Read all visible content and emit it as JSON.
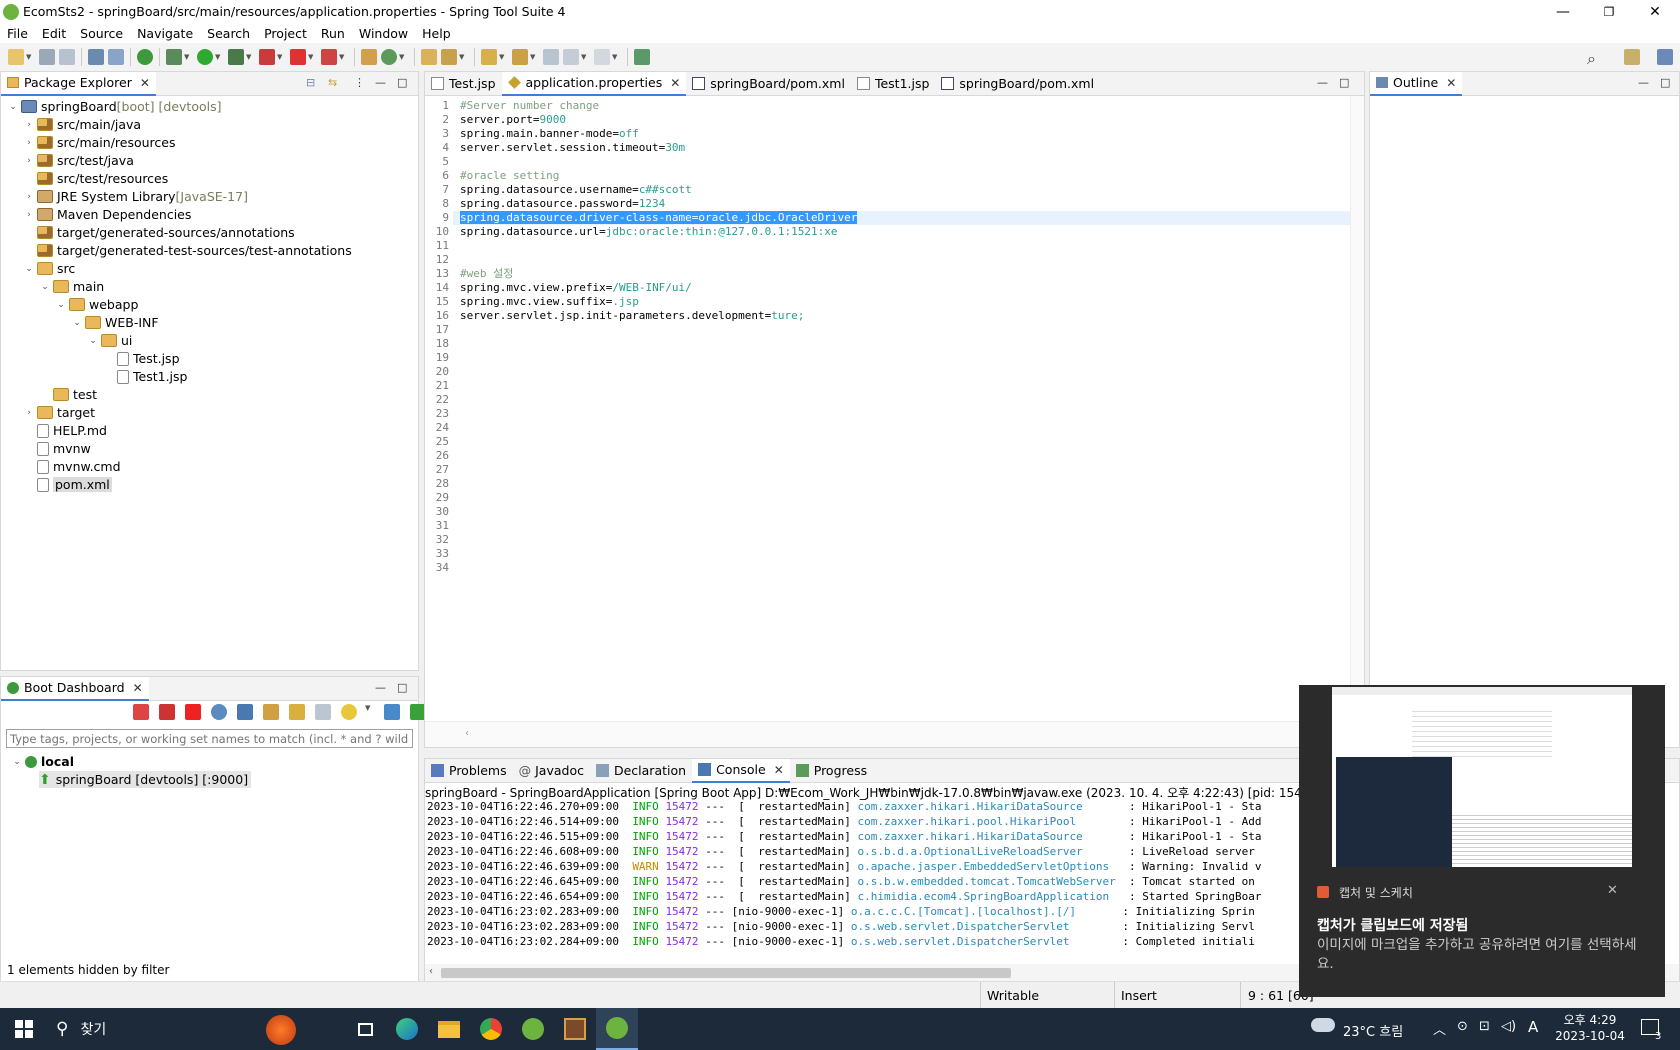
{
  "window": {
    "title": "EcomSts2 - springBoard/src/main/resources/application.properties - Spring Tool Suite 4",
    "minimize": "—",
    "maximize": "❐",
    "close": "✕"
  },
  "menu": [
    "File",
    "Edit",
    "Source",
    "Navigate",
    "Search",
    "Project",
    "Run",
    "Window",
    "Help"
  ],
  "package_explorer": {
    "tab": "Package Explorer",
    "tree": [
      {
        "label": "springBoard",
        "deco": " [boot] [devtools]",
        "indent": 0,
        "twisty": "⌄",
        "icon": "project"
      },
      {
        "label": "src/main/java",
        "indent": 1,
        "twisty": "›",
        "icon": "pkgf"
      },
      {
        "label": "src/main/resources",
        "indent": 1,
        "twisty": "›",
        "icon": "pkgf"
      },
      {
        "label": "src/test/java",
        "indent": 1,
        "twisty": "›",
        "icon": "pkgf"
      },
      {
        "label": "src/test/resources",
        "indent": 1,
        "twisty": "",
        "icon": "pkgf"
      },
      {
        "label": "JRE System Library",
        "deco": " [JavaSE-17]",
        "indent": 1,
        "twisty": "›",
        "icon": "lib"
      },
      {
        "label": "Maven Dependencies",
        "indent": 1,
        "twisty": "›",
        "icon": "lib"
      },
      {
        "label": "target/generated-sources/annotations",
        "indent": 1,
        "twisty": "",
        "icon": "pkgf"
      },
      {
        "label": "target/generated-test-sources/test-annotations",
        "indent": 1,
        "twisty": "",
        "icon": "pkgf"
      },
      {
        "label": "src",
        "indent": 1,
        "twisty": "⌄",
        "icon": "folder"
      },
      {
        "label": "main",
        "indent": 2,
        "twisty": "⌄",
        "icon": "folder"
      },
      {
        "label": "webapp",
        "indent": 3,
        "twisty": "⌄",
        "icon": "folder"
      },
      {
        "label": "WEB-INF",
        "indent": 4,
        "twisty": "⌄",
        "icon": "folder"
      },
      {
        "label": "ui",
        "indent": 5,
        "twisty": "⌄",
        "icon": "folder"
      },
      {
        "label": "Test.jsp",
        "indent": 6,
        "twisty": "",
        "icon": "file"
      },
      {
        "label": "Test1.jsp",
        "indent": 6,
        "twisty": "",
        "icon": "file"
      },
      {
        "label": "test",
        "indent": 2,
        "twisty": "",
        "icon": "folder"
      },
      {
        "label": "target",
        "indent": 1,
        "twisty": "›",
        "icon": "folder"
      },
      {
        "label": "HELP.md",
        "indent": 1,
        "twisty": "",
        "icon": "file"
      },
      {
        "label": "mvnw",
        "indent": 1,
        "twisty": "",
        "icon": "file"
      },
      {
        "label": "mvnw.cmd",
        "indent": 1,
        "twisty": "",
        "icon": "file"
      },
      {
        "label": "pom.xml",
        "indent": 1,
        "twisty": "",
        "icon": "file",
        "selected": true
      }
    ]
  },
  "boot_dashboard": {
    "tab": "Boot Dashboard",
    "filter_placeholder": "Type tags, projects, or working set names to match (incl. * and ? wildcards)",
    "local": "local",
    "app": "springBoard [devtools] [:9000]",
    "hidden_note": "1 elements hidden by filter"
  },
  "editor_tabs": [
    {
      "label": "Test.jsp",
      "active": false
    },
    {
      "label": "application.properties",
      "active": true
    },
    {
      "label": "springBoard/pom.xml",
      "active": false
    },
    {
      "label": "Test1.jsp",
      "active": false
    },
    {
      "label": "springBoard/pom.xml",
      "active": false
    }
  ],
  "editor": {
    "line_count": 34,
    "selected_line": 9,
    "lines": [
      [
        {
          "t": "#Server number change",
          "c": "c"
        }
      ],
      [
        {
          "t": "server.port=",
          "c": "k"
        },
        {
          "t": "9000",
          "c": "val"
        }
      ],
      [
        {
          "t": "spring.main.banner-mode=",
          "c": "k"
        },
        {
          "t": "off",
          "c": "val"
        }
      ],
      [
        {
          "t": "server.servlet.session.timeout=",
          "c": "k"
        },
        {
          "t": "30m",
          "c": "val"
        }
      ],
      [],
      [
        {
          "t": "#oracle setting",
          "c": "c"
        }
      ],
      [
        {
          "t": "spring.datasource.username=",
          "c": "k"
        },
        {
          "t": "c##scott",
          "c": "val"
        }
      ],
      [
        {
          "t": "spring.datasource.password=",
          "c": "k"
        },
        {
          "t": "1234",
          "c": "val"
        }
      ],
      [
        {
          "t": "spring.datasource.driver-class-name=oracle.jdbc.OracleDriver",
          "c": "sel"
        }
      ],
      [
        {
          "t": "spring.datasource.url=",
          "c": "k"
        },
        {
          "t": "jdbc:oracle:thin:@127.0.0.1:1521:xe",
          "c": "val"
        }
      ],
      [],
      [],
      [
        {
          "t": "#web 설정",
          "c": "c"
        }
      ],
      [
        {
          "t": "spring.mvc.view.prefix=",
          "c": "k"
        },
        {
          "t": "/WEB-INF/ui/",
          "c": "val"
        }
      ],
      [
        {
          "t": "spring.mvc.view.suffix=",
          "c": "k"
        },
        {
          "t": ".jsp",
          "c": "val"
        }
      ],
      [
        {
          "t": "server.servlet.jsp.init-parameters.development=",
          "c": "k"
        },
        {
          "t": "ture;",
          "c": "val"
        }
      ]
    ]
  },
  "outline": {
    "tab": "Outline"
  },
  "bottom_tabs": [
    "Problems",
    "Javadoc",
    "Declaration",
    "Console",
    "Progress"
  ],
  "console": {
    "header": "springBoard - SpringBoardApplication [Spring Boot App] D:₩Ecom_Work_JH₩bin₩jdk-17.0.8₩bin₩javaw.exe  (2023. 10. 4. 오후 4:22:43) [pid: 15472]",
    "rows": [
      {
        "ts": "2023-10-04T16:22:46.270+09:00",
        "lvl": "INFO",
        "pid": "15472",
        "thr": "---  [  restartedMain]",
        "logger": "com.zaxxer.hikari.HikariDataSource",
        "msg": ": HikariPool-1 - Sta"
      },
      {
        "ts": "2023-10-04T16:22:46.514+09:00",
        "lvl": "INFO",
        "pid": "15472",
        "thr": "---  [  restartedMain]",
        "logger": "com.zaxxer.hikari.pool.HikariPool",
        "msg": ": HikariPool-1 - Add"
      },
      {
        "ts": "2023-10-04T16:22:46.515+09:00",
        "lvl": "INFO",
        "pid": "15472",
        "thr": "---  [  restartedMain]",
        "logger": "com.zaxxer.hikari.HikariDataSource",
        "msg": ": HikariPool-1 - Sta"
      },
      {
        "ts": "2023-10-04T16:22:46.608+09:00",
        "lvl": "INFO",
        "pid": "15472",
        "thr": "---  [  restartedMain]",
        "logger": "o.s.b.d.a.OptionalLiveReloadServer",
        "msg": ": LiveReload server"
      },
      {
        "ts": "2023-10-04T16:22:46.639+09:00",
        "lvl": "WARN",
        "pid": "15472",
        "thr": "---  [  restartedMain]",
        "logger": "o.apache.jasper.EmbeddedServletOptions",
        "msg": ": Warning: Invalid v"
      },
      {
        "ts": "2023-10-04T16:22:46.645+09:00",
        "lvl": "INFO",
        "pid": "15472",
        "thr": "---  [  restartedMain]",
        "logger": "o.s.b.w.embedded.tomcat.TomcatWebServer",
        "msg": ": Tomcat started on"
      },
      {
        "ts": "2023-10-04T16:22:46.654+09:00",
        "lvl": "INFO",
        "pid": "15472",
        "thr": "---  [  restartedMain]",
        "logger": "c.himidia.ecom4.SpringBoardApplication",
        "msg": ": Started SpringBoar"
      },
      {
        "ts": "2023-10-04T16:23:02.283+09:00",
        "lvl": "INFO",
        "pid": "15472",
        "thr": "--- [nio-9000-exec-1]",
        "logger": "o.a.c.c.C.[Tomcat].[localhost].[/]",
        "msg": ": Initializing Sprin"
      },
      {
        "ts": "2023-10-04T16:23:02.283+09:00",
        "lvl": "INFO",
        "pid": "15472",
        "thr": "--- [nio-9000-exec-1]",
        "logger": "o.s.web.servlet.DispatcherServlet",
        "msg": ": Initializing Servl"
      },
      {
        "ts": "2023-10-04T16:23:02.284+09:00",
        "lvl": "INFO",
        "pid": "15472",
        "thr": "--- [nio-9000-exec-1]",
        "logger": "o.s.web.servlet.DispatcherServlet",
        "msg": ": Completed initiali"
      }
    ]
  },
  "status": {
    "mode": "Writable",
    "insert": "Insert",
    "pos": "9 : 61 [60]"
  },
  "notification": {
    "app": "캡처 및 스케치",
    "title": "캡처가 클립보드에 저장됨",
    "body": "이미지에 마크업을 추가하고 공유하려면 여기를 선택하세요."
  },
  "taskbar": {
    "search": "찾기",
    "weather": "23°C  흐림",
    "ime": "A",
    "time": "오후 4:29",
    "date": "2023-10-04",
    "notif_count": "3"
  }
}
